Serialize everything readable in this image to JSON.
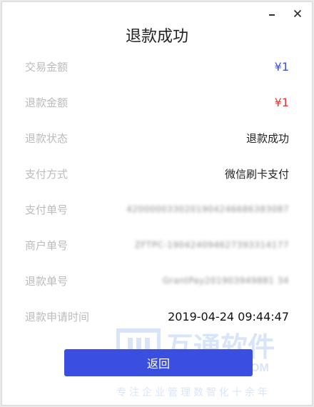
{
  "window": {
    "title": "退款成功",
    "minimize_icon": "minimize-icon",
    "close_icon": "close-icon"
  },
  "fields": [
    {
      "label": "交易金额",
      "value": "¥1",
      "style": "blue"
    },
    {
      "label": "退款金额",
      "value": "¥1",
      "style": "red"
    },
    {
      "label": "退款状态",
      "value": "退款成功",
      "style": "normal"
    },
    {
      "label": "支付方式",
      "value": "微信刷卡支付",
      "style": "normal"
    },
    {
      "label": "支付单号",
      "value": "4200000330201904246686383087",
      "style": "blurred"
    },
    {
      "label": "商户单号",
      "value": "ZFTPC-190424094627393314177",
      "style": "blurred"
    },
    {
      "label": "退款单号",
      "value": "GrantPay201903949881 34",
      "style": "blurred"
    },
    {
      "label": "退款申请时间",
      "value": "2019-04-24 09:44:47",
      "style": "time"
    }
  ],
  "actions": {
    "back_label": "返回"
  },
  "watermark": {
    "brand": "互通软件",
    "domain": "NG.COM",
    "slogan": "专注企业管理数智化十余年"
  },
  "colors": {
    "accent": "#3a4fe0",
    "amount_blue": "#3b4fd8",
    "amount_red": "#e53935",
    "label_gray": "#bbbbbb"
  }
}
